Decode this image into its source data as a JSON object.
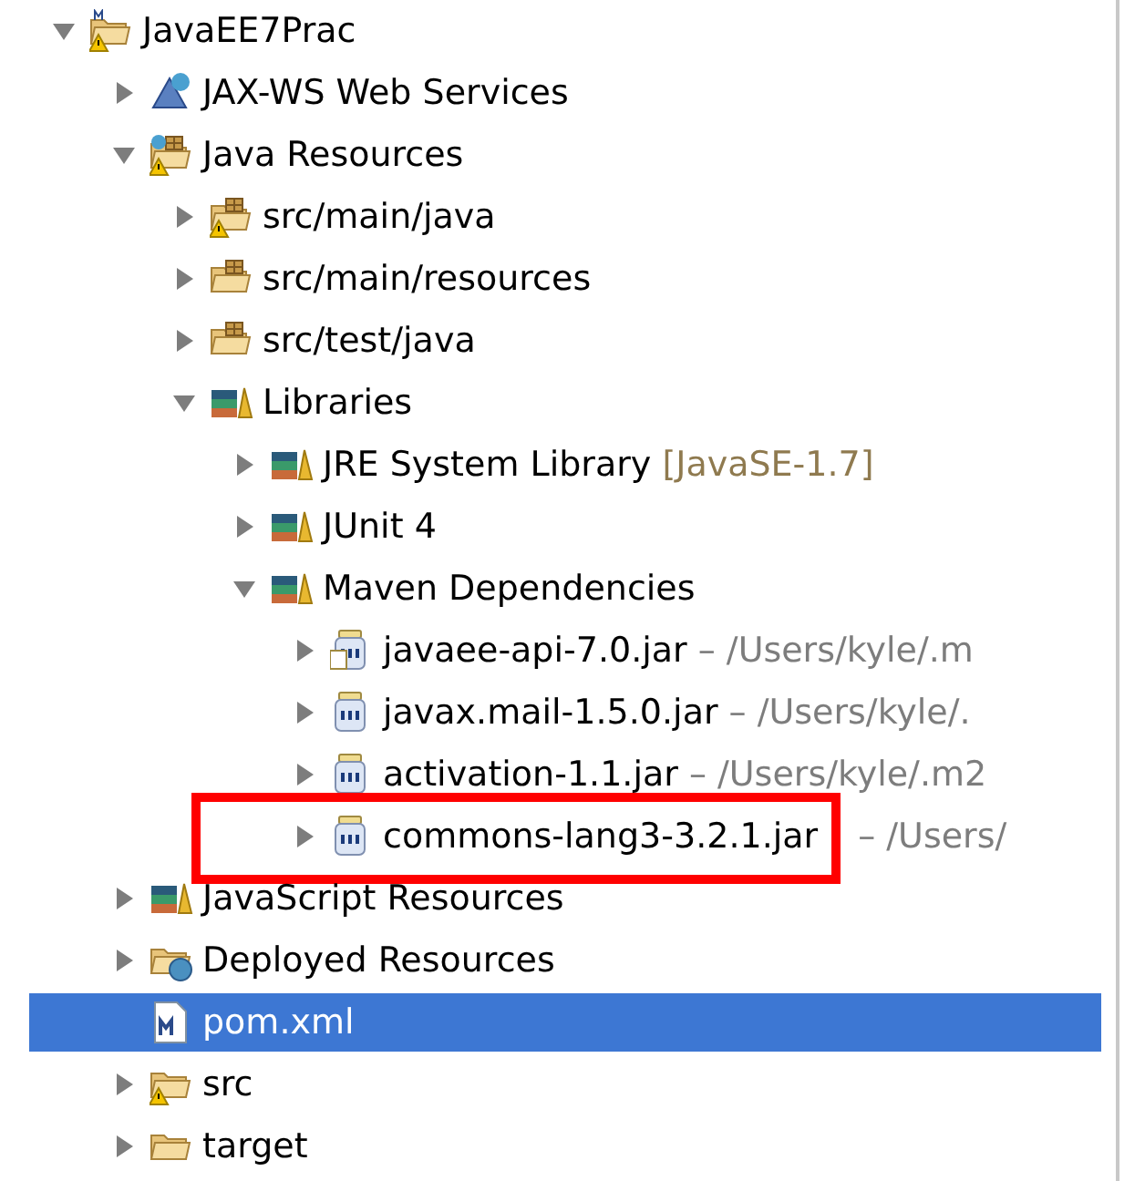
{
  "tree": [
    {
      "label": "JavaEE7Prac",
      "kind": "project",
      "warning": true,
      "expanded": true,
      "selected": false,
      "children": [
        {
          "label": "JAX-WS Web Services",
          "kind": "webservices",
          "warning": false,
          "expanded": false,
          "selected": false
        },
        {
          "label": "Java Resources",
          "kind": "javaresources",
          "warning": true,
          "expanded": true,
          "selected": false,
          "children": [
            {
              "label": "src/main/java",
              "kind": "package",
              "warning": true,
              "expanded": false,
              "selected": false
            },
            {
              "label": "src/main/resources",
              "kind": "package",
              "warning": false,
              "expanded": false,
              "selected": false
            },
            {
              "label": "src/test/java",
              "kind": "package",
              "warning": false,
              "expanded": false,
              "selected": false
            },
            {
              "label": "Libraries",
              "kind": "library",
              "warning": false,
              "expanded": true,
              "selected": false,
              "children": [
                {
                  "label": "JRE System Library",
                  "decoration": "[JavaSE-1.7]",
                  "color": "#8f7a4f",
                  "kind": "library",
                  "warning": false,
                  "expanded": false,
                  "selected": false
                },
                {
                  "label": "JUnit 4",
                  "kind": "library",
                  "warning": false,
                  "expanded": false,
                  "selected": false
                },
                {
                  "label": "Maven Dependencies",
                  "kind": "library",
                  "warning": false,
                  "expanded": true,
                  "selected": false,
                  "children": [
                    {
                      "label": "javaee-api-7.0.jar",
                      "decoration": "– /Users/kyle/.m",
                      "color": "#7d7d7d",
                      "kind": "jar-source",
                      "warning": false,
                      "expanded": false,
                      "selected": false
                    },
                    {
                      "label": "javax.mail-1.5.0.jar",
                      "decoration": "– /Users/kyle/.",
                      "color": "#7d7d7d",
                      "kind": "jar",
                      "warning": false,
                      "expanded": false,
                      "selected": false
                    },
                    {
                      "label": "activation-1.1.jar",
                      "decoration": "– /Users/kyle/.m2",
                      "color": "#7d7d7d",
                      "kind": "jar",
                      "warning": false,
                      "expanded": false,
                      "selected": false
                    },
                    {
                      "label": "commons-lang3-3.2.1.jar",
                      "decoration": "– /Users/",
                      "color": "#7d7d7d",
                      "kind": "jar",
                      "warning": false,
                      "expanded": false,
                      "selected": false,
                      "highlighted": true
                    }
                  ]
                }
              ]
            }
          ]
        },
        {
          "label": "JavaScript Resources",
          "kind": "library",
          "warning": false,
          "expanded": false,
          "selected": false
        },
        {
          "label": "Deployed Resources",
          "kind": "deployed",
          "warning": false,
          "expanded": false,
          "selected": false
        },
        {
          "label": "pom.xml",
          "kind": "pom",
          "warning": false,
          "selected": true
        },
        {
          "label": "src",
          "kind": "folder",
          "warning": true,
          "expanded": false,
          "selected": false
        },
        {
          "label": "target",
          "kind": "folder",
          "warning": false,
          "expanded": false,
          "selected": false
        }
      ]
    }
  ]
}
